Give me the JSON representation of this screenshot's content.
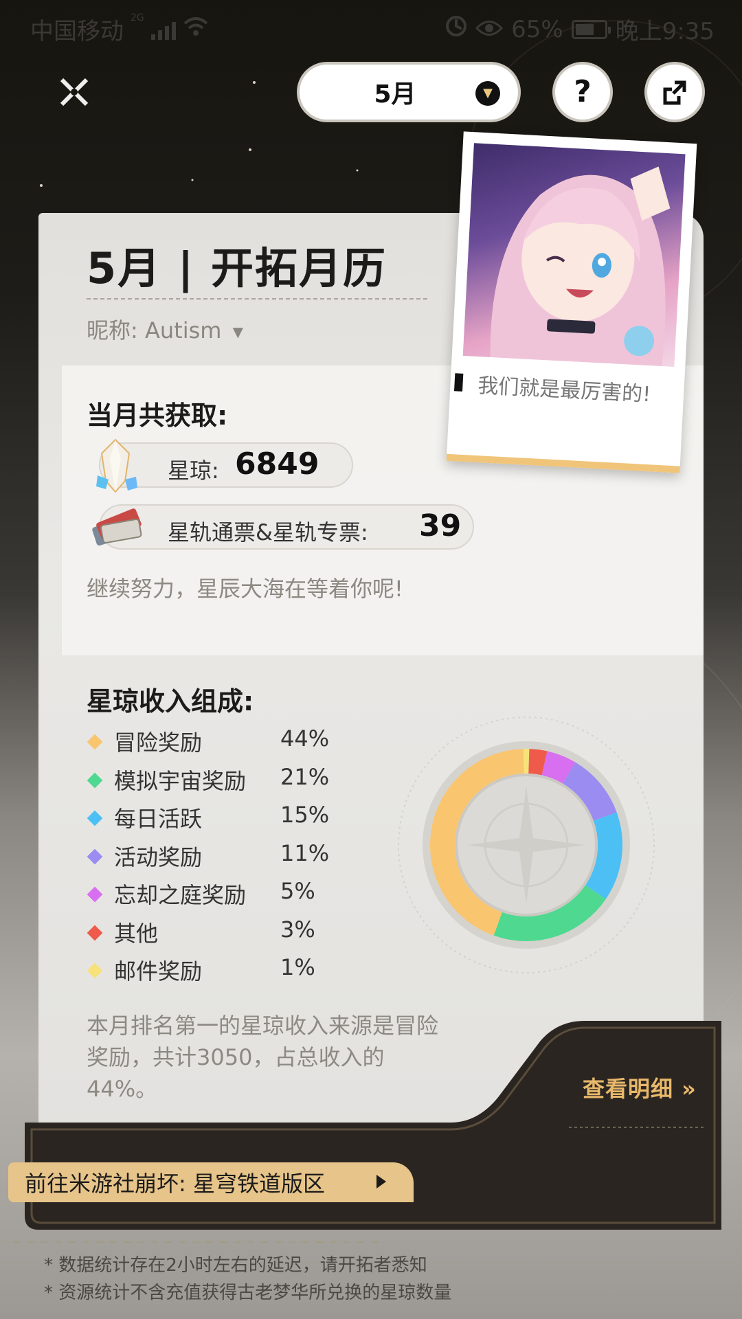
{
  "status_bar": {
    "carrier": "中国移动",
    "network": "2G",
    "battery": "65%",
    "battery_level": 0.65,
    "time": "晚上9:35"
  },
  "top_bar": {
    "month_label": "5月"
  },
  "card": {
    "title": "5月 | 开拓月历",
    "nickname_label": "昵称:",
    "nickname": "Autism",
    "income_heading": "当月共获取:",
    "stellar_jade_label": "星琼:",
    "stellar_jade_value": "6849",
    "pass_label": "星轨通票&星轨专票:",
    "pass_value": "39",
    "encourage": "继续努力，星辰大海在等着你呢!",
    "composition_heading": "星琼收入组成:",
    "summary": "本月排名第一的星琼收入来源是冒险奖励，共计3050，占总收入的44%。"
  },
  "polaroid": {
    "caption": "我们就是最厉害的!"
  },
  "chart_data": {
    "type": "pie",
    "title": "星琼收入组成:",
    "categories": [
      "冒险奖励",
      "模拟宇宙奖励",
      "每日活跃",
      "活动奖励",
      "忘却之庭奖励",
      "其他",
      "邮件奖励"
    ],
    "values": [
      44,
      21,
      15,
      11,
      5,
      3,
      1
    ],
    "labels": [
      "44%",
      "21%",
      "15%",
      "11%",
      "5%",
      "3%",
      "1%"
    ],
    "colors": [
      "#f9c56f",
      "#4fd890",
      "#4cc0f5",
      "#9a8cf0",
      "#d86ef0",
      "#ef5a4a",
      "#f7e27a"
    ],
    "legend": "left"
  },
  "bottom": {
    "detail_link": "查看明细 »",
    "goto_button": "前往米游社崩坏: 星穹铁道版区",
    "footnote1": "* 数据统计存在2小时左右的延迟，请开拓者悉知",
    "footnote2": "* 资源统计不含充值获得古老梦华所兑换的星琼数量"
  }
}
